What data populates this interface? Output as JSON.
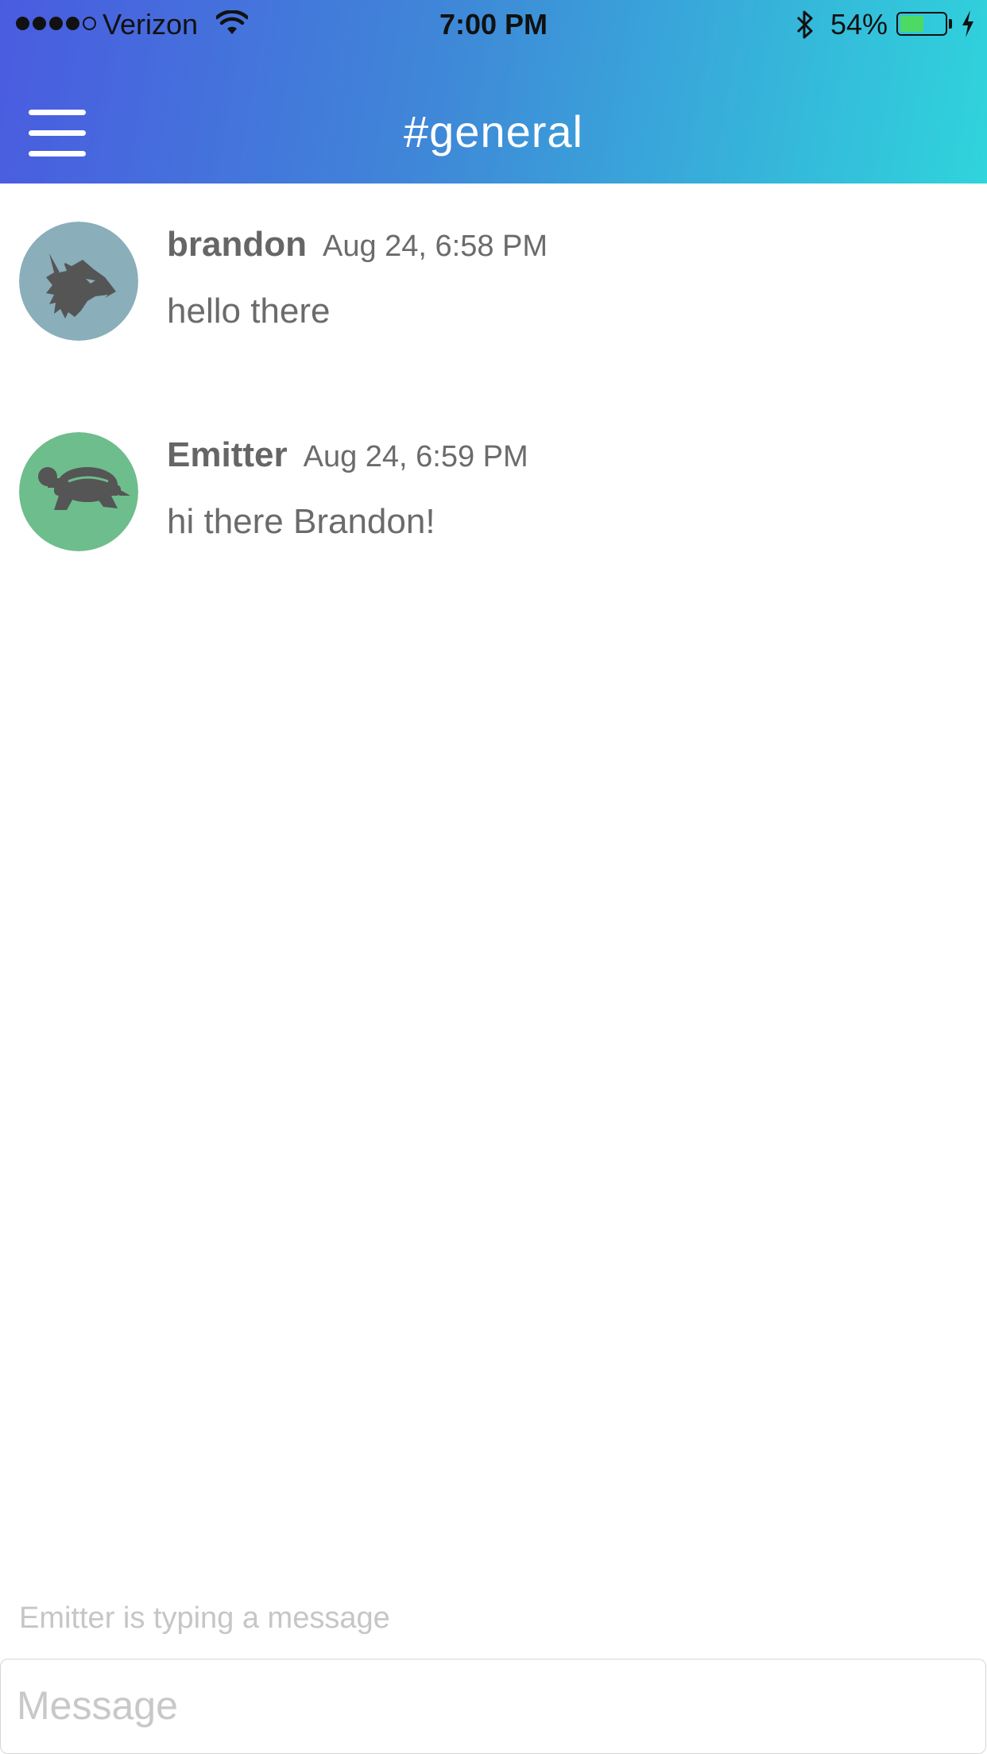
{
  "status_bar": {
    "signal_bars_filled": 4,
    "signal_bars_total": 5,
    "carrier": "Verizon",
    "time": "7:00 PM",
    "battery_percent_label": "54%",
    "battery_level": 0.54,
    "icons": [
      "signal-icon",
      "wifi-icon",
      "bluetooth-icon",
      "battery-icon",
      "charging-bolt-icon"
    ]
  },
  "header": {
    "menu_icon": "hamburger-menu-icon",
    "channel_title": "#general",
    "gradient_colors": [
      "#4a5be0",
      "#3f88d8",
      "#2fd4dc"
    ]
  },
  "messages": [
    {
      "author": "brandon",
      "timestamp": "Aug 24, 6:58 PM",
      "text": "hello there",
      "avatar_icon": "wolf-avatar-icon",
      "avatar_color": "#8aaeba"
    },
    {
      "author": "Emitter",
      "timestamp": "Aug 24, 6:59 PM",
      "text": "hi there Brandon!",
      "avatar_icon": "turtle-avatar-icon",
      "avatar_color": "#6ebd8c"
    }
  ],
  "typing_indicator": "Emitter is typing a message",
  "composer": {
    "placeholder": "Message",
    "value": ""
  }
}
